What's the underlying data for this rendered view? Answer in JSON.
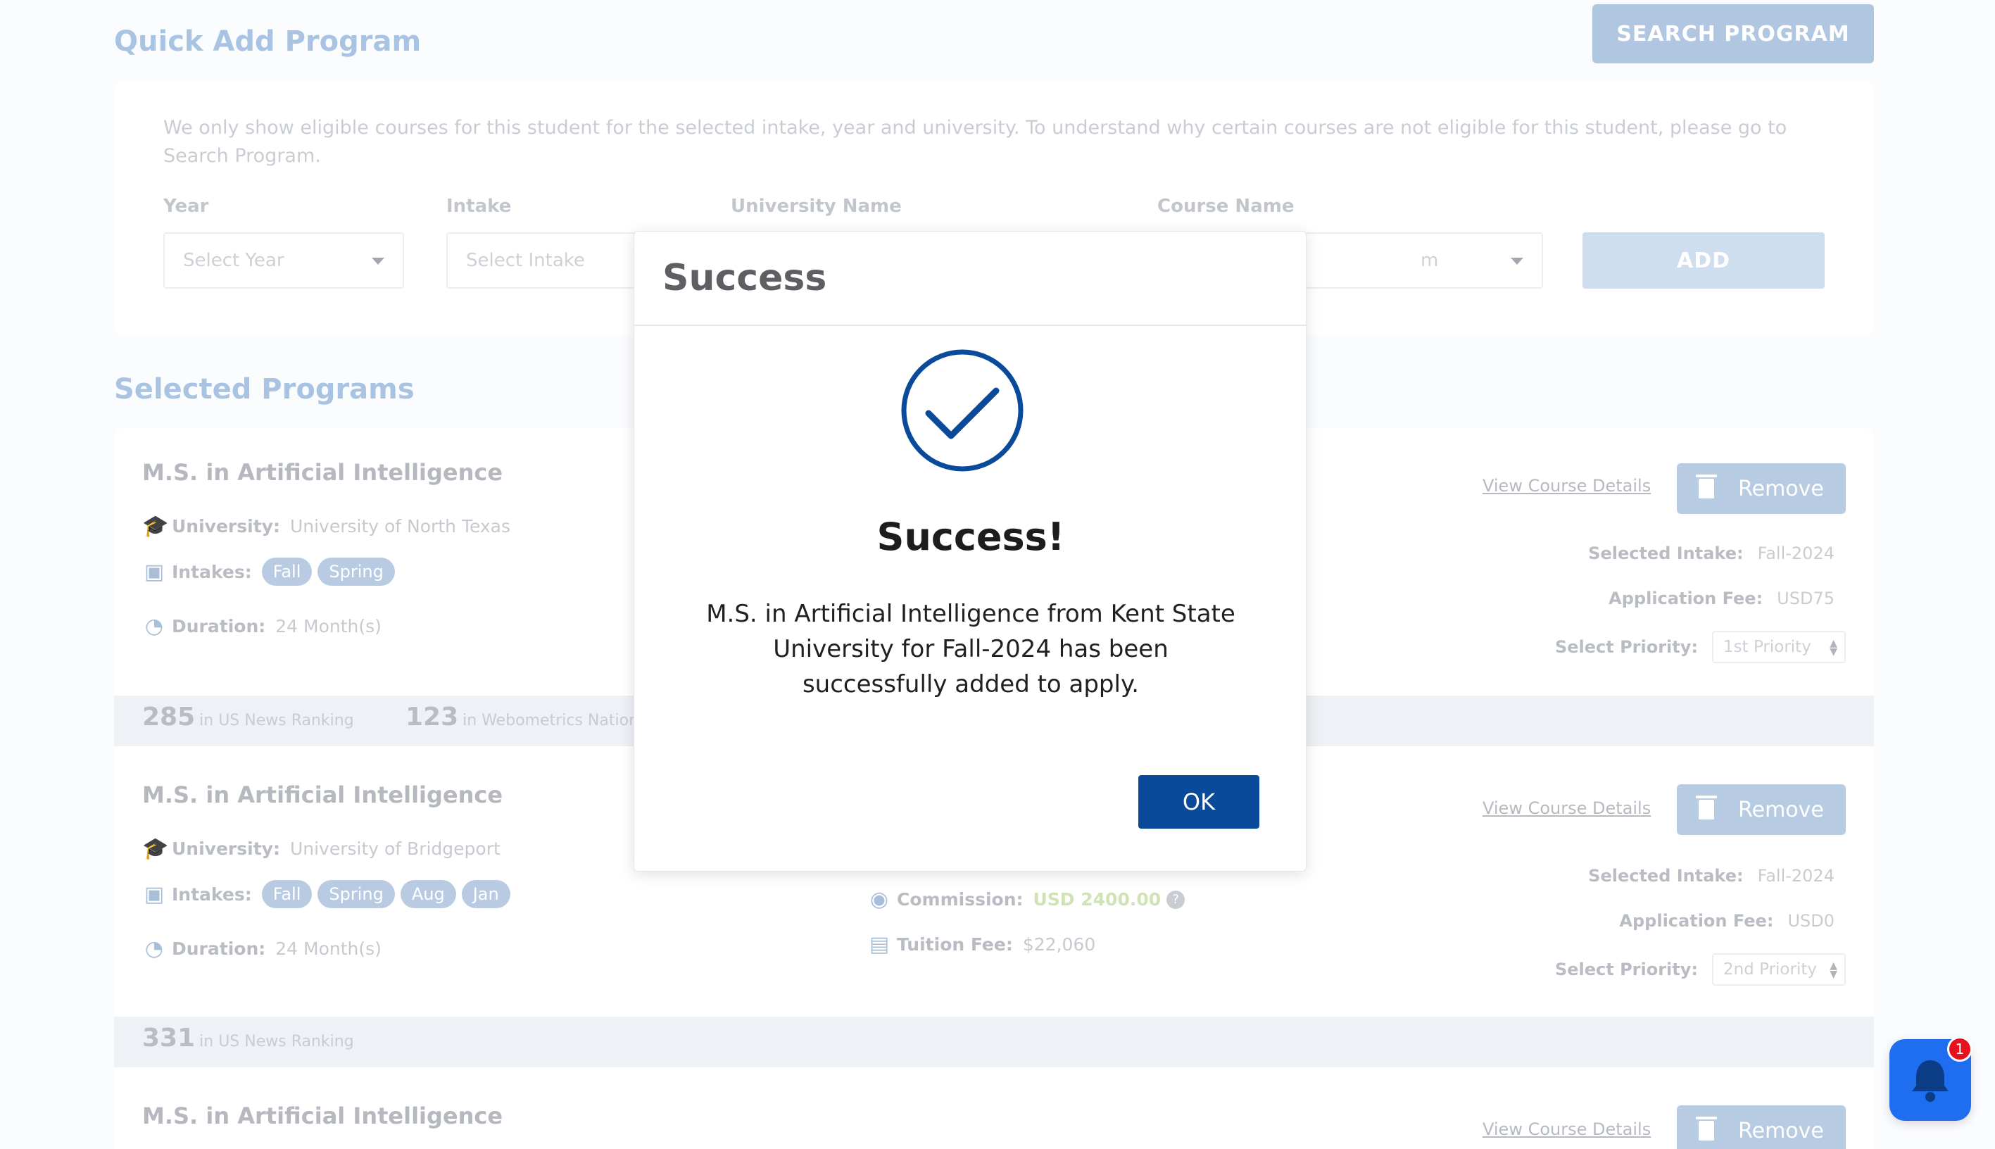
{
  "quick_add": {
    "title": "Quick Add Program",
    "search_button": "SEARCH PROGRAM",
    "hint": "We only show eligible courses for this student for the selected intake, year and university. To understand why certain courses are not eligible for this student, please go to Search Program.",
    "year_label": "Year",
    "year_placeholder": "Select Year",
    "intake_label": "Intake",
    "intake_placeholder": "Select Intake",
    "university_label": "University Name",
    "course_label": "Course Name",
    "course_value_fragment": "m",
    "add_button": "ADD"
  },
  "selected_programs": {
    "title": "Selected Programs",
    "programs": [
      {
        "title": "M.S. in Artificial Intelligence",
        "university_label": "University:",
        "university": "University of North Texas",
        "intakes_label": "Intakes:",
        "intakes": [
          "Fall",
          "Spring"
        ],
        "duration_label": "Duration:",
        "duration": "24 Month(s)",
        "view_details": "View Course Details",
        "remove": "Remove",
        "selected_intake_label": "Selected Intake:",
        "selected_intake": "Fall-2024",
        "app_fee_label": "Application Fee:",
        "app_fee": "USD75",
        "priority_label": "Select Priority:",
        "priority": "1st Priority",
        "rankings": [
          {
            "num": "285",
            "label": "in US News Ranking"
          },
          {
            "num": "123",
            "label": "in Webometrics Nationa"
          }
        ]
      },
      {
        "title": "M.S. in Artificial Intelligence",
        "university_label": "University:",
        "university": "University of Bridgeport",
        "intakes_label": "Intakes:",
        "intakes": [
          "Fall",
          "Spring",
          "Aug",
          "Jan"
        ],
        "duration_label": "Duration:",
        "duration": "24 Month(s)",
        "commission_label": "Commission:",
        "commission": "USD 2400.00",
        "tuition_label": "Tuition Fee:",
        "tuition": "$22,060",
        "view_details": "View Course Details",
        "remove": "Remove",
        "selected_intake_label": "Selected Intake:",
        "selected_intake": "Fall-2024",
        "app_fee_label": "Application Fee:",
        "app_fee": "USD0",
        "priority_label": "Select Priority:",
        "priority": "2nd Priority",
        "rankings": [
          {
            "num": "331",
            "label": "in US News Ranking"
          }
        ]
      },
      {
        "title": "M.S. in Artificial Intelligence",
        "view_details": "View Course Details",
        "remove": "Remove"
      }
    ]
  },
  "modal": {
    "header": "Success",
    "title": "Success!",
    "message": "M.S. in Artificial Intelligence from Kent State University for Fall-2024 has been successfully added to apply.",
    "ok": "OK"
  },
  "notifications": {
    "count": "1"
  },
  "colors": {
    "primary": "#0a4a9a",
    "notify": "#1f6ef0",
    "badge": "#e8101e",
    "commission": "#cfe3b5"
  }
}
